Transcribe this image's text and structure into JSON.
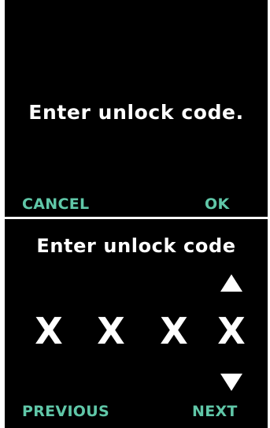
{
  "top_screen": {
    "message": "Enter unlock code.",
    "left_softkey": "CANCEL",
    "right_softkey": "OK"
  },
  "bottom_screen": {
    "title": "Enter unlock code",
    "digits": [
      "X",
      "X",
      "X",
      "X"
    ],
    "up_icon": "arrow-up-icon",
    "down_icon": "arrow-down-icon",
    "left_softkey": "PREVIOUS",
    "right_softkey": "NEXT"
  },
  "colors": {
    "background": "#000000",
    "text": "#ffffff",
    "accent": "#60c7a8"
  }
}
